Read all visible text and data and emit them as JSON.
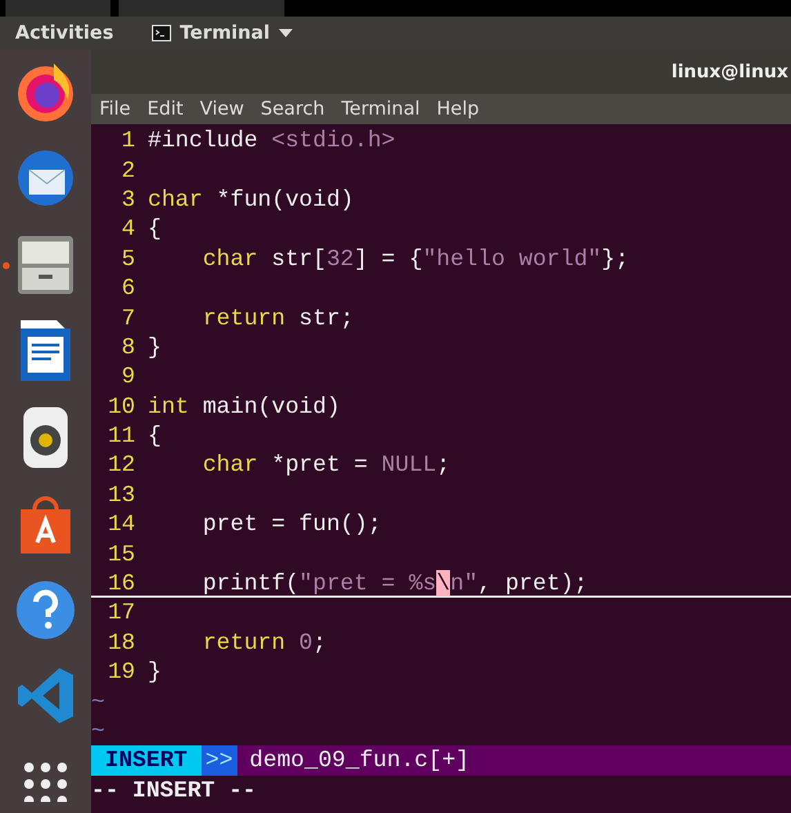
{
  "top_bar": {
    "activities": "Activities",
    "app_menu": "Terminal"
  },
  "dock": {
    "items": [
      {
        "kind": "firefox",
        "running": false
      },
      {
        "kind": "mail",
        "running": false
      },
      {
        "kind": "files",
        "running": true
      },
      {
        "kind": "writer",
        "running": false
      },
      {
        "kind": "speaker",
        "running": false
      },
      {
        "kind": "software",
        "running": false
      },
      {
        "kind": "help",
        "running": false
      },
      {
        "kind": "vscode",
        "running": false
      },
      {
        "kind": "apps",
        "running": false
      }
    ]
  },
  "window": {
    "title": "linux@linux",
    "menu": [
      "File",
      "Edit",
      "View",
      "Search",
      "Terminal",
      "Help"
    ]
  },
  "editor": {
    "lines": [
      {
        "number": "1",
        "current": false,
        "segments": [
          {
            "kind": "preproc",
            "text": "#include "
          },
          {
            "kind": "string",
            "text": "<stdio.h>"
          }
        ]
      },
      {
        "number": "2",
        "current": false
      },
      {
        "number": "3",
        "current": false,
        "segments": [
          {
            "kind": "keyword",
            "text": "char"
          },
          {
            "kind": "plain",
            "text": " *fun(void)"
          }
        ]
      },
      {
        "number": "4",
        "current": false,
        "segments": [
          {
            "kind": "plain",
            "text": "{"
          }
        ]
      },
      {
        "number": "5",
        "current": false,
        "segments": [
          {
            "kind": "keyword",
            "text": "    char"
          },
          {
            "kind": "plain",
            "text": " str["
          },
          {
            "kind": "string",
            "text": "32"
          },
          {
            "kind": "plain",
            "text": "] = {"
          },
          {
            "kind": "string",
            "text": "\"hello world\""
          },
          {
            "kind": "plain",
            "text": "};"
          }
        ]
      },
      {
        "number": "6",
        "current": false
      },
      {
        "number": "7",
        "current": false,
        "segments": [
          {
            "kind": "keyword",
            "text": "    return"
          },
          {
            "kind": "plain",
            "text": " str;"
          }
        ]
      },
      {
        "number": "8",
        "current": false,
        "segments": [
          {
            "kind": "plain",
            "text": "}"
          }
        ]
      },
      {
        "number": "9",
        "current": false
      },
      {
        "number": "10",
        "current": false,
        "segments": [
          {
            "kind": "keyword",
            "text": "int"
          },
          {
            "kind": "plain",
            "text": " main(void)"
          }
        ]
      },
      {
        "number": "11",
        "current": false,
        "segments": [
          {
            "kind": "plain",
            "text": "{"
          }
        ]
      },
      {
        "number": "12",
        "current": false,
        "segments": [
          {
            "kind": "keyword",
            "text": "    char"
          },
          {
            "kind": "plain",
            "text": " *pret = "
          },
          {
            "kind": "string",
            "text": "NULL"
          },
          {
            "kind": "plain",
            "text": ";"
          }
        ]
      },
      {
        "number": "13",
        "current": false
      },
      {
        "number": "14",
        "current": false,
        "segments": [
          {
            "kind": "plain",
            "text": "    pret = fun();"
          }
        ]
      },
      {
        "number": "15",
        "current": false
      },
      {
        "number": "16",
        "current": true,
        "segments": [
          {
            "kind": "plain",
            "text": "    printf("
          },
          {
            "kind": "string",
            "text": "\"pret = %s"
          },
          {
            "kind": "cursor",
            "text": "\\"
          },
          {
            "kind": "string",
            "text": "n\""
          },
          {
            "kind": "plain",
            "text": ", pret);"
          }
        ]
      },
      {
        "number": "17",
        "current": false
      },
      {
        "number": "18",
        "current": false,
        "segments": [
          {
            "kind": "keyword",
            "text": "    return"
          },
          {
            "kind": "string",
            "text": " 0"
          },
          {
            "kind": "plain",
            "text": ";"
          }
        ]
      },
      {
        "number": "19",
        "current": false,
        "segments": [
          {
            "kind": "plain",
            "text": "}"
          }
        ]
      }
    ],
    "fillers": [
      "~",
      "~"
    ]
  },
  "status_line": {
    "mode": "INSERT",
    "separator": ">>",
    "file": "demo_09_fun.c[+]"
  },
  "command_line": "-- INSERT --"
}
